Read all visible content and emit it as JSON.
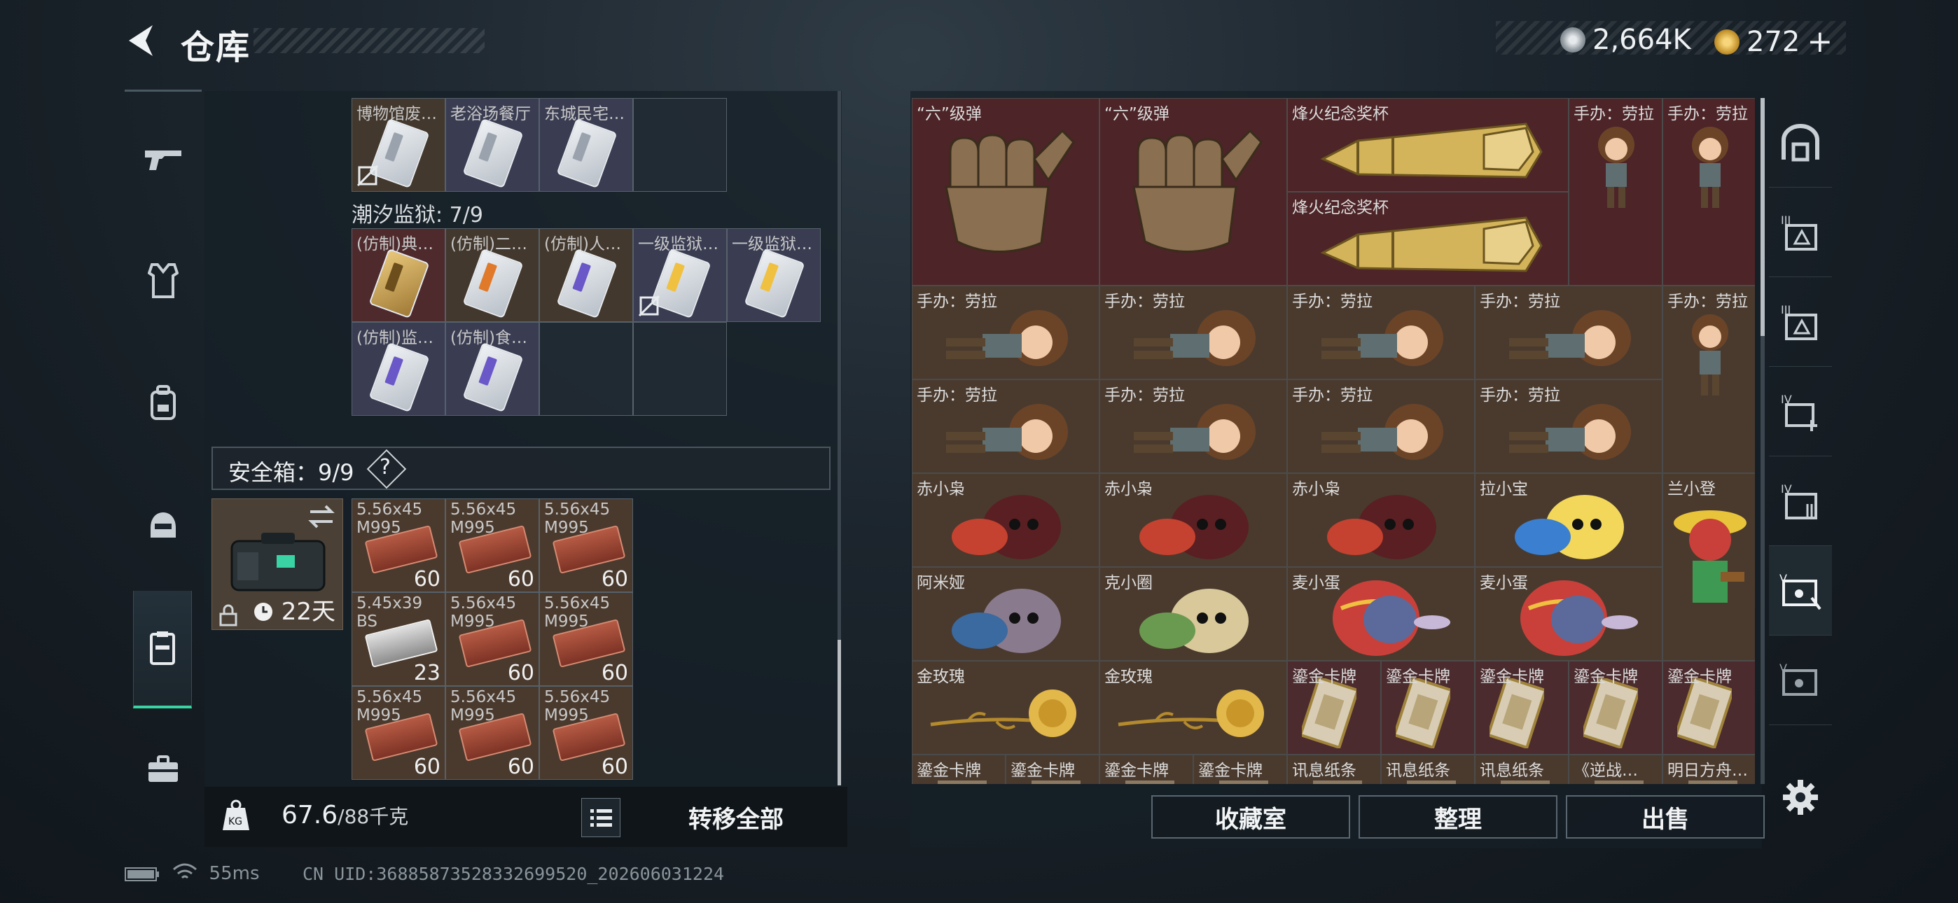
{
  "header": {
    "title": "仓库"
  },
  "currency": {
    "silver": "2,664K",
    "gold": "272",
    "add": "+"
  },
  "left_nav": [
    "gun-icon",
    "armor-icon",
    "backpack-icon",
    "helmet-icon",
    "safebox-icon",
    "toolbox-icon"
  ],
  "left_panel": {
    "row1_items": [
      "博物馆废…",
      "老浴场餐厅",
      "东城民宅…"
    ],
    "prison_title": "潮汐监狱: 7/9",
    "prison_items": [
      "(仿制)典…",
      "(仿制)二…",
      "(仿制)人…",
      "一级监狱…",
      "一级监狱…",
      "(仿制)监…",
      "(仿制)食…"
    ],
    "safebox_label": "安全箱：9/9",
    "help": "?",
    "case_days": "22天",
    "ammo": [
      {
        "l1": "5.56x45",
        "l2": "M995",
        "count": "60"
      },
      {
        "l1": "5.56x45",
        "l2": "M995",
        "count": "60"
      },
      {
        "l1": "5.56x45",
        "l2": "M995",
        "count": "60"
      },
      {
        "l1": "5.45x39",
        "l2": "BS",
        "count": "23"
      },
      {
        "l1": "5.56x45",
        "l2": "M995",
        "count": "60"
      },
      {
        "l1": "5.56x45",
        "l2": "M995",
        "count": "60"
      },
      {
        "l1": "5.56x45",
        "l2": "M995",
        "count": "60"
      },
      {
        "l1": "5.56x45",
        "l2": "M995",
        "count": "60"
      },
      {
        "l1": "5.56x45",
        "l2": "M995",
        "count": "60"
      }
    ],
    "weight_current": "67.6",
    "weight_max": "/88千克",
    "transfer_all": "转移全部"
  },
  "right_panel": {
    "big_items": [
      "“六”级弹",
      "“六”级弹",
      "烽火纪念奖杯",
      "烽火纪念奖杯"
    ],
    "lara": "手办：劳拉",
    "chi": "赤小枭",
    "la": "拉小宝",
    "lan": "兰小登",
    "ami": "阿米娅",
    "ke": "克小圈",
    "mai": "麦小蛋",
    "rose": "金玫瑰",
    "goldcard": "鎏金卡牌",
    "xunxi": "讯息纸条",
    "nizhan": "《逆战…",
    "mingri": "明日方舟…",
    "buttons": {
      "collection": "收藏室",
      "sort": "整理",
      "sell": "出售"
    }
  },
  "right_nav": [
    "vault-icon",
    "storage-III-a-icon",
    "storage-III-b-icon",
    "storage-IV-add-icon",
    "storage-IV-icon",
    "collection-icon",
    "collection-alt-icon"
  ],
  "status": {
    "ping": "55ms",
    "uid": "CN UID:3688587352833269952​0_202606031224"
  },
  "colors": {
    "accent": "#39d3a4",
    "item_red": "#4d2427",
    "item_brown": "#4a3a2e"
  }
}
